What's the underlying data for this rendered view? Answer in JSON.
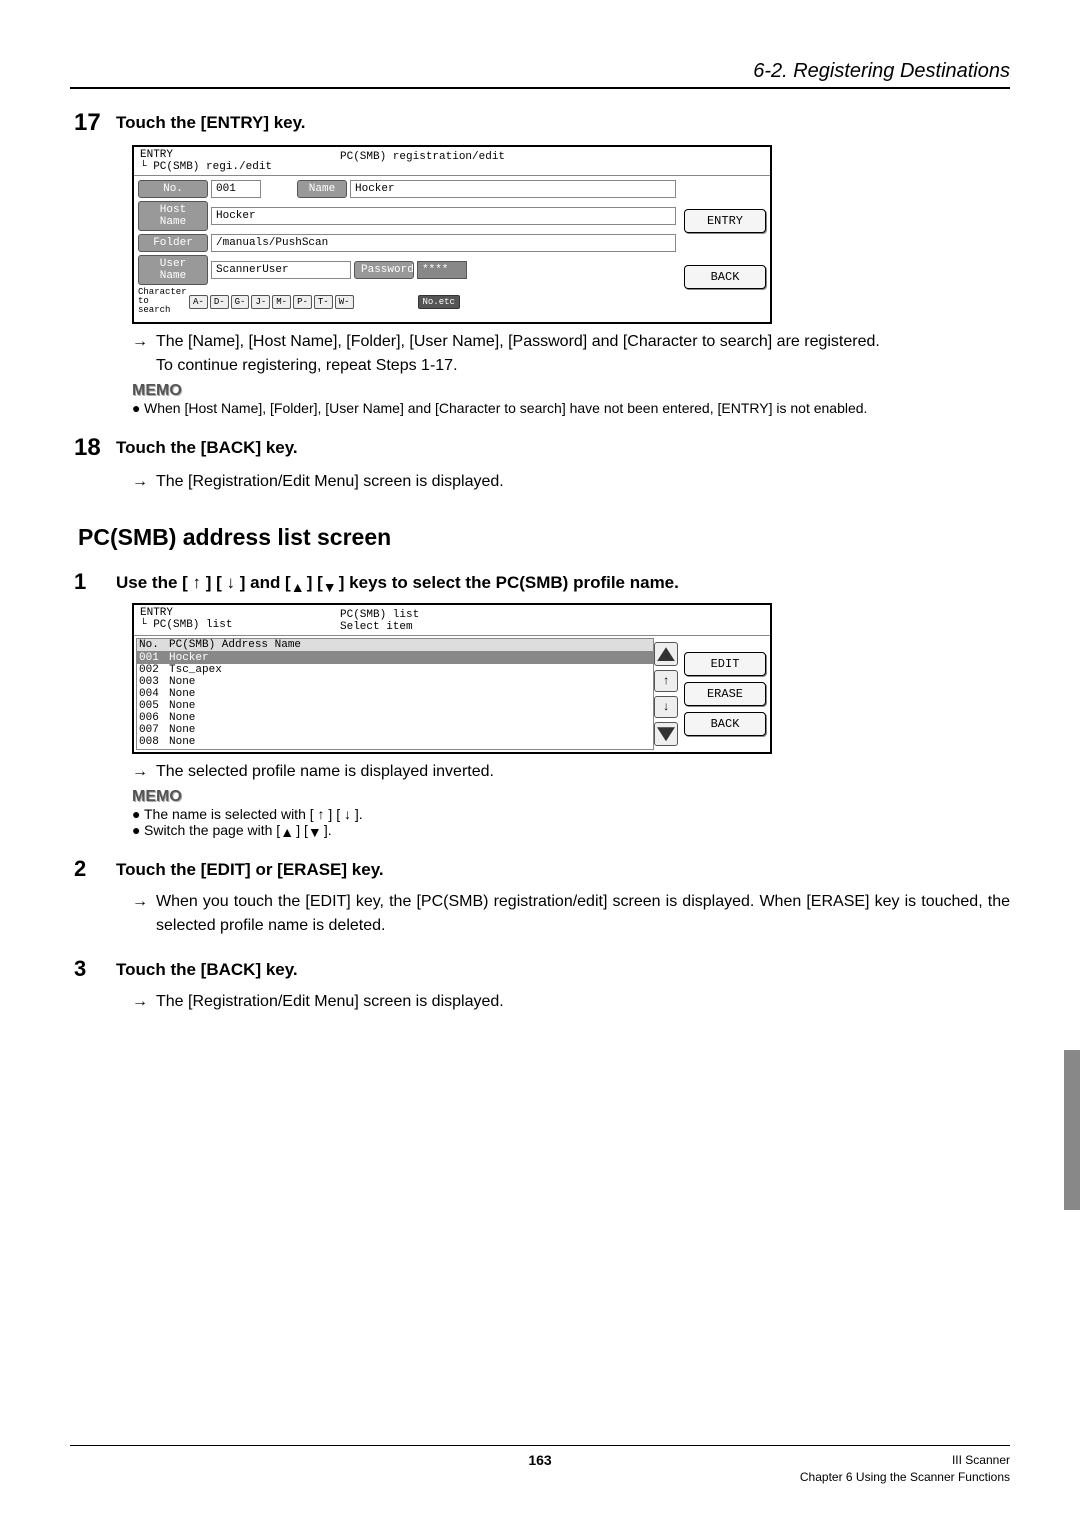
{
  "header": {
    "section": "6-2. Registering Destinations"
  },
  "step17": {
    "num": "17",
    "title": "Touch the [ENTRY] key.",
    "screenshot": {
      "bc_top": "ENTRY",
      "bc_sub": "PC(SMB) regi./edit",
      "center": "PC(SMB) registration/edit",
      "row_no_l": "No.",
      "row_no_v": "001",
      "row_name_l": "Name",
      "row_name_v": "Hocker",
      "row_host_l": "Host Name",
      "row_host_v": "Hocker",
      "row_folder_l": "Folder",
      "row_folder_v": "/manuals/PushScan",
      "row_user_l": "User Name",
      "row_user_v": "ScannerUser",
      "row_pass_l": "Password",
      "row_pass_v": "****",
      "char_l": "Character to search",
      "keys": [
        "A-",
        "D-",
        "G-",
        "J-",
        "M-",
        "P-",
        "T-",
        "W-"
      ],
      "key_etc": "No.etc",
      "btn_entry": "ENTRY",
      "btn_back": "BACK"
    },
    "result": "The [Name], [Host Name], [Folder], [User Name], [Password] and [Character to search] are registered.",
    "note1": "To continue registering, repeat Steps 1-17.",
    "memo_label": "MEMO",
    "memo1": "When [Host Name], [Folder], [User Name] and [Character to search] have not been entered, [ENTRY] is not enabled."
  },
  "step18": {
    "num": "18",
    "title": "Touch the [BACK] key.",
    "result": "The [Registration/Edit Menu] screen is displayed."
  },
  "heading2": "PC(SMB) address list screen",
  "step1": {
    "num": "1",
    "title_a": "Use the [ ↑ ] [ ↓ ] and [",
    "title_b": "] [",
    "title_c": "] keys to select the PC(SMB) profile name.",
    "screenshot": {
      "bc_top": "ENTRY",
      "bc_sub": "PC(SMB) list",
      "center1": "PC(SMB) list",
      "center2": "Select item",
      "col_no": "No.",
      "col_name": "PC(SMB) Address Name",
      "rows": [
        {
          "no": "001",
          "name": "Hocker"
        },
        {
          "no": "002",
          "name": "Tsc_apex"
        },
        {
          "no": "003",
          "name": "None"
        },
        {
          "no": "004",
          "name": "None"
        },
        {
          "no": "005",
          "name": "None"
        },
        {
          "no": "006",
          "name": "None"
        },
        {
          "no": "007",
          "name": "None"
        },
        {
          "no": "008",
          "name": "None"
        }
      ],
      "btn_edit": "EDIT",
      "btn_erase": "ERASE",
      "btn_back": "BACK"
    },
    "result": "The selected profile name is displayed inverted.",
    "memo_label": "MEMO",
    "memo1": "The name is selected with [ ↑ ] [ ↓ ].",
    "memo2a": "Switch the page with [",
    "memo2b": "] [",
    "memo2c": "]."
  },
  "step2": {
    "num": "2",
    "title": "Touch the [EDIT] or [ERASE] key.",
    "result": "When you touch the [EDIT] key, the [PC(SMB) registration/edit] screen is displayed. When [ERASE] key is touched, the selected profile name is deleted."
  },
  "step3": {
    "num": "3",
    "title": "Touch the [BACK] key.",
    "result": "The [Registration/Edit Menu] screen is displayed."
  },
  "footer": {
    "page": "163",
    "right1": "III Scanner",
    "right2": "Chapter 6 Using the Scanner Functions"
  }
}
